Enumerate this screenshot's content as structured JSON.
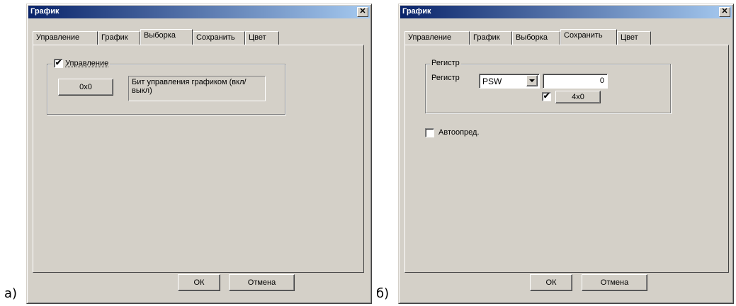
{
  "figure_labels": {
    "a": "а)",
    "b": "б)"
  },
  "dialog_a": {
    "title": "График",
    "close_glyph": "✕",
    "tabs": [
      "Управление",
      "График",
      "Выборка",
      "Сохранить",
      "Цвет"
    ],
    "active_tab": "Выборка",
    "group": {
      "checkbox_checked": true,
      "checkbox_label": "Управление",
      "value_button": "0x0",
      "description": "Бит управления графиком (вкл/выкл)"
    },
    "ok_label": "ОК",
    "cancel_label": "Отмена"
  },
  "dialog_b": {
    "title": "График",
    "close_glyph": "✕",
    "tabs": [
      "Управление",
      "График",
      "Выборка",
      "Сохранить",
      "Цвет"
    ],
    "active_tab": "Сохранить",
    "group": {
      "legend": "Регистр",
      "register_label": "Регистр",
      "register_select": "PSW",
      "register_value": "0",
      "mask_checked": true,
      "mask_button": "4x0"
    },
    "auto_checkbox_checked": false,
    "auto_label": "Автоопред.",
    "ok_label": "ОК",
    "cancel_label": "Отмена"
  }
}
